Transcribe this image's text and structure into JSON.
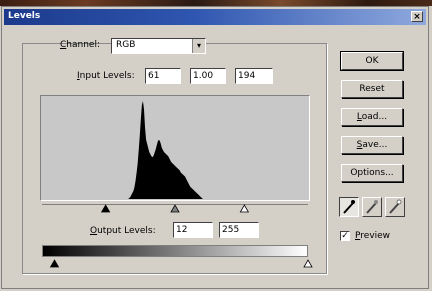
{
  "window": {
    "title": "Levels",
    "close_glyph": "×"
  },
  "channel": {
    "label_prefix": "",
    "label_mnemonic": "C",
    "label_rest": "hannel:",
    "value": "RGB",
    "arrow_glyph": "▾"
  },
  "input_levels": {
    "label_prefix": "",
    "label_mnemonic": "I",
    "label_rest": "nput Levels:",
    "values": [
      "61",
      "1.00",
      "194"
    ]
  },
  "output_levels": {
    "label_prefix": "",
    "label_mnemonic": "O",
    "label_rest": "utput Levels:",
    "values": [
      "12",
      "255"
    ]
  },
  "buttons": {
    "ok": {
      "label": "OK"
    },
    "reset": {
      "label": "Reset"
    },
    "load": {
      "mnemonic": "L",
      "rest": "oad..."
    },
    "save": {
      "mnemonic": "S",
      "rest": "ave..."
    },
    "options": {
      "label": "Options..."
    }
  },
  "pickers": [
    "black-eyedropper-icon",
    "gray-eyedropper-icon",
    "white-eyedropper-icon"
  ],
  "preview": {
    "mnemonic": "P",
    "rest": "review",
    "checked": true,
    "check_glyph": "✓"
  },
  "histogram": {
    "bins": [
      0,
      0,
      0,
      0,
      0,
      0,
      0,
      0,
      0,
      0,
      0,
      0,
      0,
      0,
      0,
      0,
      0,
      0,
      0,
      0,
      0,
      0,
      0,
      0,
      0,
      0,
      0,
      0,
      0,
      0,
      0,
      0,
      0,
      0,
      0,
      0,
      0,
      0,
      0,
      0,
      0,
      0,
      0,
      0,
      0,
      0,
      0,
      0,
      0,
      0,
      0,
      0,
      0,
      0,
      0,
      0,
      0,
      0,
      0,
      0,
      0,
      0,
      0,
      0,
      0,
      0,
      0,
      0,
      0,
      0,
      0,
      0,
      0,
      0,
      0,
      0,
      0,
      0,
      0,
      0,
      0,
      0,
      0,
      1,
      2,
      4,
      6,
      8,
      12,
      18,
      26,
      35,
      48,
      62,
      78,
      92,
      96,
      88,
      70,
      58,
      54,
      50,
      46,
      44,
      42,
      41,
      42,
      45,
      48,
      52,
      56,
      58,
      57,
      54,
      50,
      48,
      46,
      45,
      44,
      43,
      42,
      40,
      38,
      36,
      35,
      34,
      33,
      32,
      31,
      30,
      29,
      28,
      26,
      25,
      24,
      23,
      22,
      20,
      18,
      16,
      14,
      12,
      11,
      10,
      9,
      8,
      7,
      6,
      5,
      4,
      3,
      2,
      1,
      0,
      0,
      0,
      0,
      0,
      0,
      0,
      0,
      0,
      0,
      0,
      0,
      0,
      0,
      0,
      0,
      0,
      0,
      0,
      0,
      0,
      0,
      0,
      0,
      0,
      0,
      0,
      0,
      0,
      0,
      0,
      0,
      0,
      0,
      0,
      0,
      0,
      0,
      0,
      0,
      0,
      0,
      0,
      0,
      0,
      0,
      0,
      0,
      0,
      0,
      0,
      0,
      0,
      0,
      0,
      0,
      0,
      0,
      0,
      0,
      0,
      0,
      0,
      0,
      0,
      0,
      0,
      0,
      0,
      0,
      0,
      0,
      0,
      0,
      0,
      0,
      0,
      0,
      0,
      0,
      0,
      0,
      0,
      0,
      0,
      0,
      0,
      0,
      0,
      0,
      0,
      0,
      0,
      0,
      0,
      0,
      0,
      0,
      0,
      0,
      0
    ],
    "input_black": 61,
    "input_gamma": 1.0,
    "input_white": 194,
    "output_black": 12,
    "output_white": 255
  }
}
